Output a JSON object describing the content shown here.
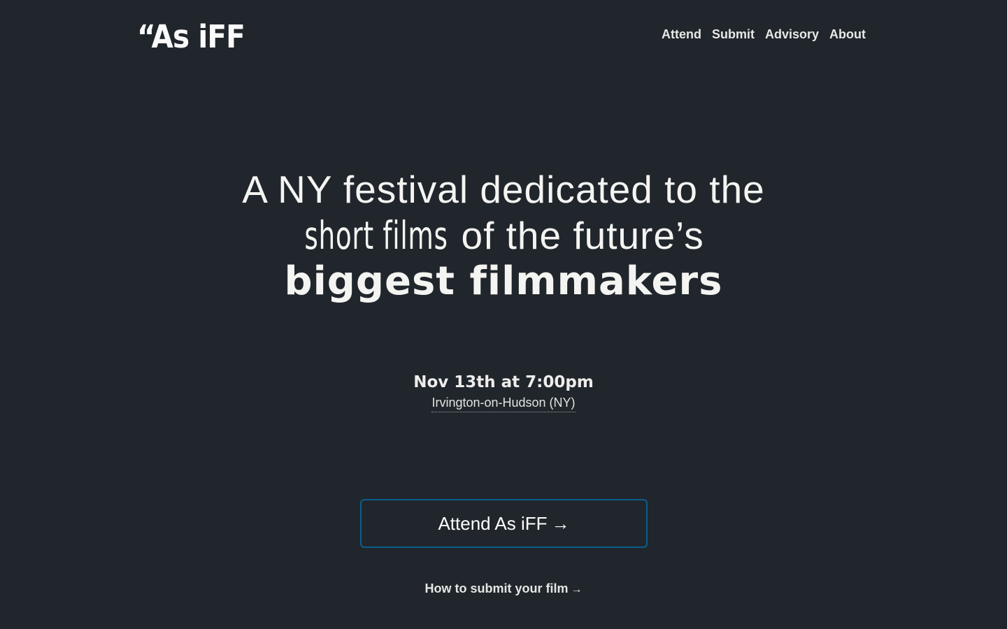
{
  "header": {
    "logo": "“As iFF",
    "nav": [
      "Attend",
      "Submit",
      "Advisory",
      "About"
    ]
  },
  "hero": {
    "line1": "A NY festival dedicated to the",
    "line2_narrow": "short films",
    "line2_rest": " of the future’s",
    "line3": "biggest filmmakers"
  },
  "event": {
    "date": "Nov 13th at 7:00pm",
    "location": "Irvington-on-Hudson (NY)"
  },
  "cta": {
    "label": "Attend As iFF",
    "arrow": "→"
  },
  "submit_link": {
    "label": "How to submit your film",
    "arrow": "→"
  },
  "colors": {
    "background": "#20262b",
    "text": "#f4f4f2",
    "button_border": "#0b5e8d"
  }
}
